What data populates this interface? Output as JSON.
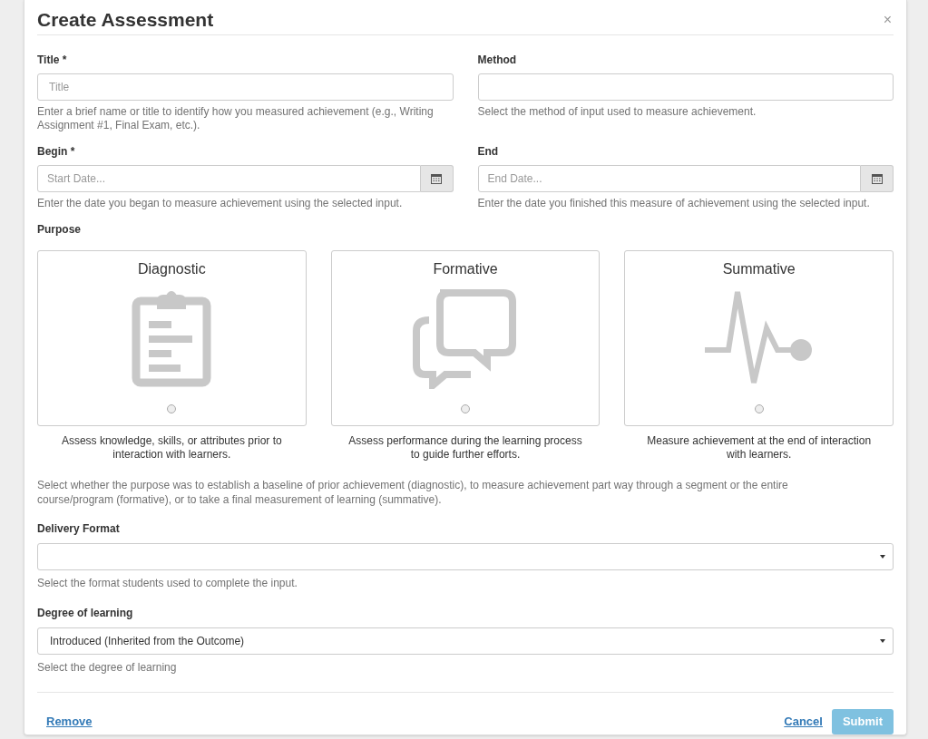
{
  "dialog": {
    "title": "Create Assessment",
    "close": "×"
  },
  "fields": [
    {
      "kind": "text",
      "label": "Title *",
      "placeholder": "Title",
      "help": "Enter a brief name or title to identify how you measured achievement (e.g., Writing Assignment #1, Final Exam, etc.)."
    },
    {
      "kind": "text",
      "label": "Method",
      "help": "Select the method of input used to measure achievement."
    },
    {
      "kind": "date",
      "label": "Begin *",
      "placeholder": "Start Date...",
      "help": "Enter the date you began to measure achievement using the selected input."
    },
    {
      "kind": "date",
      "label": "End",
      "placeholder": "End Date...",
      "help": "Enter the date you finished this measure of achievement using the selected input."
    }
  ],
  "purpose": {
    "label": "Purpose",
    "options": [
      {
        "kind": "clipboard",
        "title": "Diagnostic",
        "selected": false,
        "description": "Assess knowledge, skills, or attributes prior to interaction with learners."
      },
      {
        "kind": "chat",
        "title": "Formative",
        "selected": false,
        "description": "Assess performance during the learning process to guide further efforts."
      },
      {
        "kind": "pulse",
        "title": "Summative",
        "selected": false,
        "description": "Measure achievement at the end of interaction with learners."
      }
    ],
    "help": "Select whether the purpose was to establish a baseline of prior achievement (diagnostic), to measure achievement part way through a segment or the entire course/program (formative), or to take a final measurement of learning (summative)."
  },
  "selects": [
    {
      "label": "Delivery Format",
      "help": "Select the format students used to complete the input."
    },
    {
      "label": "Degree of learning",
      "value": "Introduced (Inherited from the Outcome)",
      "help": "Select the degree of learning"
    }
  ],
  "footer": {
    "remove": "Remove",
    "cancel": "Cancel",
    "submit": {
      "label": "Submit",
      "disabled": true
    }
  }
}
